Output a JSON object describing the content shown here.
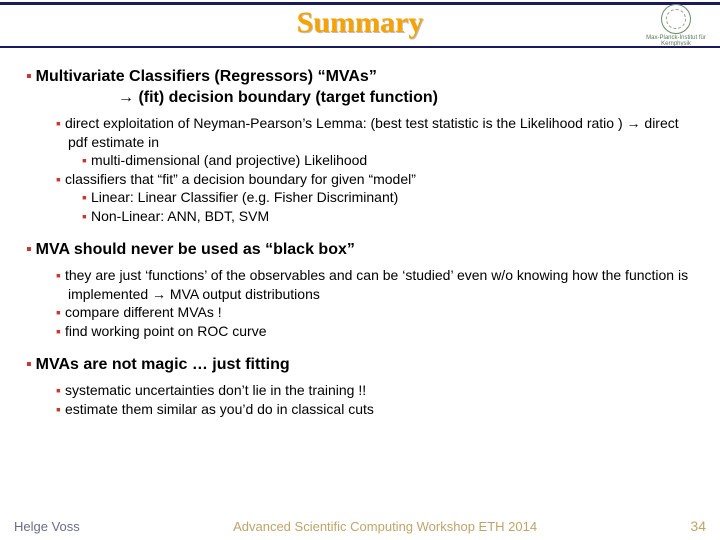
{
  "header": {
    "title": "Summary",
    "logo_text": "Max-Planck-Institut für Kernphysik"
  },
  "sections": [
    {
      "heading": "Multivariate Classifiers (Regressors)  “MVAs”",
      "heading_cont": "→ (fit) decision boundary (target function)",
      "subs": [
        {
          "text": "direct exploitation of Neyman-Pearson’s Lemma: (best test statistic is the Likelihood ratio ) → direct pdf estimate in",
          "level": 1
        },
        {
          "text": "multi-dimensional (and projective) Likelihood",
          "level": 2
        },
        {
          "text": "classifiers that “fit” a decision boundary for given “model”",
          "level": 1
        },
        {
          "text": "Linear:  Linear Classifier (e.g. Fisher Discriminant)",
          "level": 2
        },
        {
          "text": "Non-Linear:  ANN, BDT, SVM",
          "level": 2
        }
      ]
    },
    {
      "heading": "MVA should never be used as “black box”",
      "subs": [
        {
          "text": "they are just ‘functions’ of the observables and can be ‘studied’ even w/o knowing how the function is implemented → MVA output distributions",
          "level": 1
        },
        {
          "text": "compare different MVAs !",
          "level": 1
        },
        {
          "text": "find working point on ROC curve",
          "level": 1
        }
      ]
    },
    {
      "heading": "MVAs are not magic … just fitting",
      "subs": [
        {
          "text": "systematic uncertainties don’t lie in the training !!",
          "level": 1
        },
        {
          "text": "estimate them similar as you’d do in classical cuts",
          "level": 1
        }
      ]
    }
  ],
  "footer": {
    "author": "Helge Voss",
    "venue": "Advanced Scientific Computing Workshop ETH 2014",
    "page": "34"
  }
}
